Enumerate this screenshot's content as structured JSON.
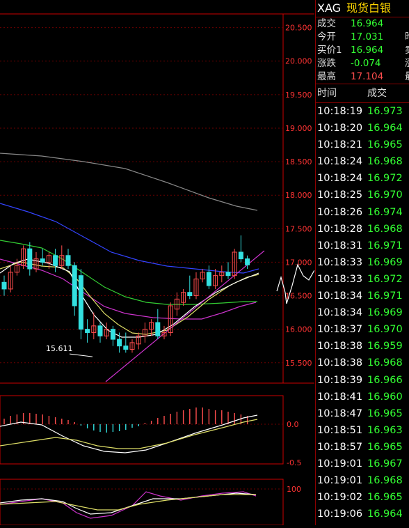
{
  "header": {
    "code": "XAG",
    "name": "现货白银"
  },
  "quote": [
    {
      "label": "成交",
      "value": "16.964",
      "color": "green",
      "extra": ""
    },
    {
      "label": "今开",
      "value": "17.031",
      "color": "green",
      "extra": "昨"
    },
    {
      "label": "买价1",
      "value": "16.964",
      "color": "green",
      "extra": "卖"
    },
    {
      "label": "涨跌",
      "value": "-0.074",
      "color": "green",
      "extra": "涨"
    },
    {
      "label": "最高",
      "value": "17.104",
      "color": "red",
      "extra": "最"
    }
  ],
  "ticks_header": {
    "time": "时间",
    "price": "成交"
  },
  "ticks": [
    {
      "time": "10:18:19",
      "price": "16.973"
    },
    {
      "time": "10:18:20",
      "price": "16.964"
    },
    {
      "time": "10:18:21",
      "price": "16.965"
    },
    {
      "time": "10:18:24",
      "price": "16.968"
    },
    {
      "time": "10:18:24",
      "price": "16.972"
    },
    {
      "time": "10:18:25",
      "price": "16.970"
    },
    {
      "time": "10:18:26",
      "price": "16.974"
    },
    {
      "time": "10:18:28",
      "price": "16.968"
    },
    {
      "time": "10:18:31",
      "price": "16.971"
    },
    {
      "time": "10:18:33",
      "price": "16.969"
    },
    {
      "time": "10:18:33",
      "price": "16.972"
    },
    {
      "time": "10:18:34",
      "price": "16.971"
    },
    {
      "time": "10:18:34",
      "price": "16.969"
    },
    {
      "time": "10:18:37",
      "price": "16.970"
    },
    {
      "time": "10:18:38",
      "price": "16.959"
    },
    {
      "time": "10:18:38",
      "price": "16.968"
    },
    {
      "time": "10:18:39",
      "price": "16.966"
    },
    {
      "time": "10:18:41",
      "price": "16.960"
    },
    {
      "time": "10:18:47",
      "price": "16.965"
    },
    {
      "time": "10:18:51",
      "price": "16.963"
    },
    {
      "time": "10:18:57",
      "price": "16.965"
    },
    {
      "time": "10:19:01",
      "price": "16.967"
    },
    {
      "time": "10:19:01",
      "price": "16.968"
    },
    {
      "time": "10:19:02",
      "price": "16.965"
    },
    {
      "time": "10:19:06",
      "price": "16.964"
    }
  ],
  "main_axis": [
    "20.500",
    "20.000",
    "19.500",
    "19.000",
    "18.500",
    "18.000",
    "17.500",
    "17.000",
    "16.500",
    "16.000",
    "15.500"
  ],
  "macd_axis": [
    "0.0",
    "-0.5"
  ],
  "kdj_axis": [
    "100"
  ],
  "min_label": "15.611",
  "chart_data": {
    "type": "candlestick",
    "instrument": "XAG 现货白银",
    "ylim": [
      15.3,
      20.6
    ],
    "min_marker": 15.611,
    "candles": [
      {
        "o": 16.7,
        "h": 16.8,
        "l": 16.5,
        "c": 16.6
      },
      {
        "o": 16.6,
        "h": 16.95,
        "l": 16.55,
        "c": 16.85
      },
      {
        "o": 16.85,
        "h": 17.05,
        "l": 16.8,
        "c": 16.95
      },
      {
        "o": 16.95,
        "h": 17.25,
        "l": 16.9,
        "c": 17.2
      },
      {
        "o": 17.2,
        "h": 17.3,
        "l": 16.8,
        "c": 16.9
      },
      {
        "o": 16.9,
        "h": 17.15,
        "l": 16.85,
        "c": 17.05
      },
      {
        "o": 17.05,
        "h": 17.2,
        "l": 16.95,
        "c": 17.0
      },
      {
        "o": 17.0,
        "h": 17.15,
        "l": 16.9,
        "c": 17.1
      },
      {
        "o": 17.1,
        "h": 17.2,
        "l": 16.85,
        "c": 16.95
      },
      {
        "o": 16.95,
        "h": 17.25,
        "l": 16.9,
        "c": 17.1
      },
      {
        "o": 17.1,
        "h": 17.2,
        "l": 16.9,
        "c": 16.95
      },
      {
        "o": 16.95,
        "h": 17.0,
        "l": 16.2,
        "c": 16.35
      },
      {
        "o": 16.8,
        "h": 16.9,
        "l": 15.85,
        "c": 16.0
      },
      {
        "o": 16.0,
        "h": 16.15,
        "l": 15.8,
        "c": 15.95
      },
      {
        "o": 15.95,
        "h": 16.25,
        "l": 15.85,
        "c": 16.05
      },
      {
        "o": 16.05,
        "h": 16.1,
        "l": 15.8,
        "c": 15.9
      },
      {
        "o": 15.9,
        "h": 16.1,
        "l": 15.85,
        "c": 16.0
      },
      {
        "o": 16.0,
        "h": 16.05,
        "l": 15.75,
        "c": 15.85
      },
      {
        "o": 15.85,
        "h": 15.95,
        "l": 15.65,
        "c": 15.75
      },
      {
        "o": 15.75,
        "h": 15.95,
        "l": 15.65,
        "c": 15.7
      },
      {
        "o": 15.7,
        "h": 15.85,
        "l": 15.65,
        "c": 15.8
      },
      {
        "o": 15.78,
        "h": 15.95,
        "l": 15.7,
        "c": 15.9
      },
      {
        "o": 15.9,
        "h": 16.1,
        "l": 15.8,
        "c": 16.0
      },
      {
        "o": 16.0,
        "h": 16.15,
        "l": 15.9,
        "c": 16.1
      },
      {
        "o": 16.1,
        "h": 16.3,
        "l": 15.85,
        "c": 15.9
      },
      {
        "o": 15.9,
        "h": 16.05,
        "l": 15.85,
        "c": 15.95
      },
      {
        "o": 15.95,
        "h": 16.4,
        "l": 15.9,
        "c": 16.35
      },
      {
        "o": 16.3,
        "h": 16.55,
        "l": 16.2,
        "c": 16.45
      },
      {
        "o": 16.4,
        "h": 16.6,
        "l": 16.35,
        "c": 16.55
      },
      {
        "o": 16.55,
        "h": 16.8,
        "l": 16.45,
        "c": 16.5
      },
      {
        "o": 16.5,
        "h": 16.85,
        "l": 16.45,
        "c": 16.75
      },
      {
        "o": 16.75,
        "h": 16.9,
        "l": 16.7,
        "c": 16.85
      },
      {
        "o": 16.85,
        "h": 16.95,
        "l": 16.6,
        "c": 16.65
      },
      {
        "o": 16.65,
        "h": 16.9,
        "l": 16.6,
        "c": 16.8
      },
      {
        "o": 16.8,
        "h": 16.95,
        "l": 16.7,
        "c": 16.85
      },
      {
        "o": 16.85,
        "h": 17.0,
        "l": 16.75,
        "c": 16.8
      },
      {
        "o": 16.8,
        "h": 17.2,
        "l": 16.75,
        "c": 17.15
      },
      {
        "o": 17.15,
        "h": 17.4,
        "l": 17.0,
        "c": 17.05
      },
      {
        "o": 17.05,
        "h": 17.1,
        "l": 16.9,
        "c": 16.96
      }
    ]
  },
  "colors": {
    "up": "#ff4d4d",
    "down": "#33e0e0",
    "axis": "#cc0000",
    "ma_gray": "#888888",
    "ma_blue": "#3344ff",
    "ma_green": "#33cc33",
    "ma_magenta": "#cc33cc",
    "ma_yellow": "#dddd66",
    "ma_white": "#ffffff"
  }
}
